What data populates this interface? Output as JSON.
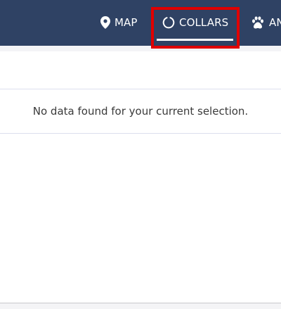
{
  "nav": {
    "map_label": "MAP",
    "collars_label": "COLLARS",
    "animals_label": "AN"
  },
  "table": {
    "empty_message": "No data found for your current selection."
  },
  "colors": {
    "topbar": "#2f4264",
    "highlight": "#e00000"
  }
}
